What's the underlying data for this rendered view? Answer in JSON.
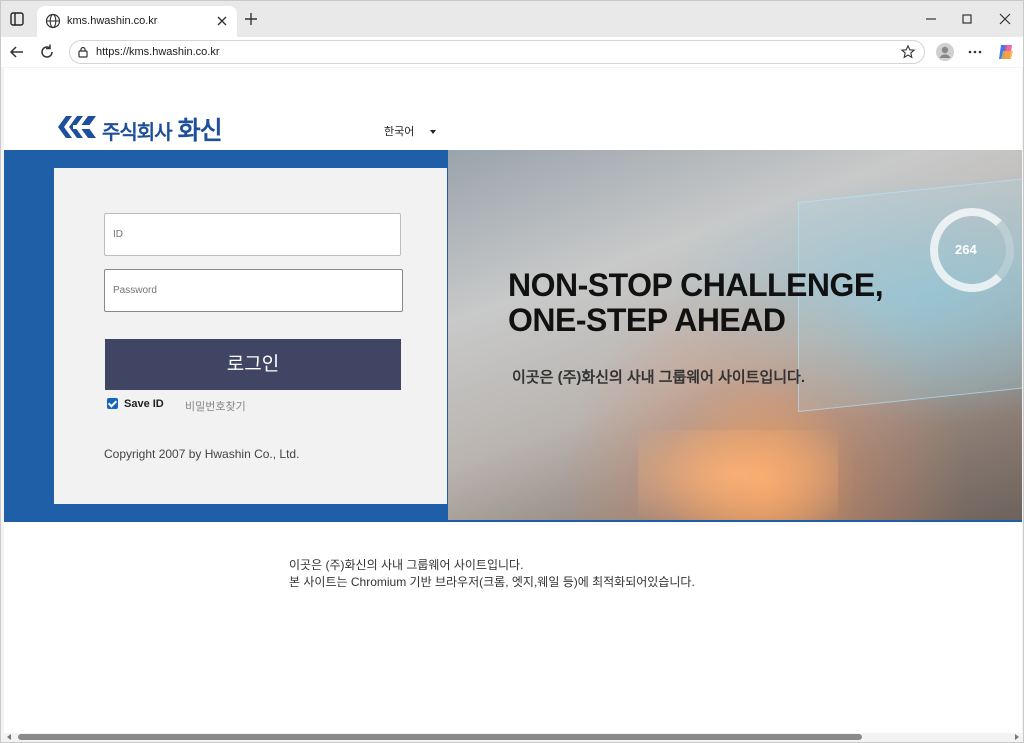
{
  "browser": {
    "tab_title": "kms.hwashin.co.kr",
    "url": "https://kms.hwashin.co.kr",
    "icons": {
      "tab_actions": "tab-actions-icon",
      "favicon": "globe-icon",
      "tab_close": "close-icon",
      "new_tab": "plus-icon",
      "back": "back-arrow-icon",
      "reload": "reload-icon",
      "lock": "lock-icon",
      "favorite": "star-icon",
      "profile": "profile-icon",
      "menu": "more-icon",
      "copilot": "copilot-icon",
      "minimize": "minimize-icon",
      "maximize": "maximize-icon",
      "close_window": "close-icon"
    }
  },
  "header": {
    "logo_text": "주식회사 화신",
    "logo_prefix": "주식회사",
    "logo_name": "화신",
    "language": "한국어"
  },
  "hero": {
    "headline_line1": "NON-STOP CHALLENGE,",
    "headline_line2": "ONE-STEP AHEAD",
    "subtitle": "이곳은 (주)화신의 사내 그룹웨어 사이트입니다.",
    "gauge_value": "264"
  },
  "login": {
    "id_placeholder": "ID",
    "password_placeholder": "Password",
    "login_button": "로그인",
    "save_id_label": "Save ID",
    "save_id_checked": true,
    "find_password": "비밀번호찾기",
    "copyright": "Copyright 2007 by Hwashin Co., Ltd."
  },
  "notice": {
    "line1": "이곳은 (주)화신의 사내 그룹웨어 사이트입니다.",
    "line2": "본 사이트는 Chromium 기반 브라우저(크롬, 엣지,웨일 등)에 최적화되어있습니다."
  },
  "colors": {
    "brand_blue": "#1f5fa8",
    "logo_blue": "#1e4f9a",
    "login_button": "#3f4563"
  }
}
